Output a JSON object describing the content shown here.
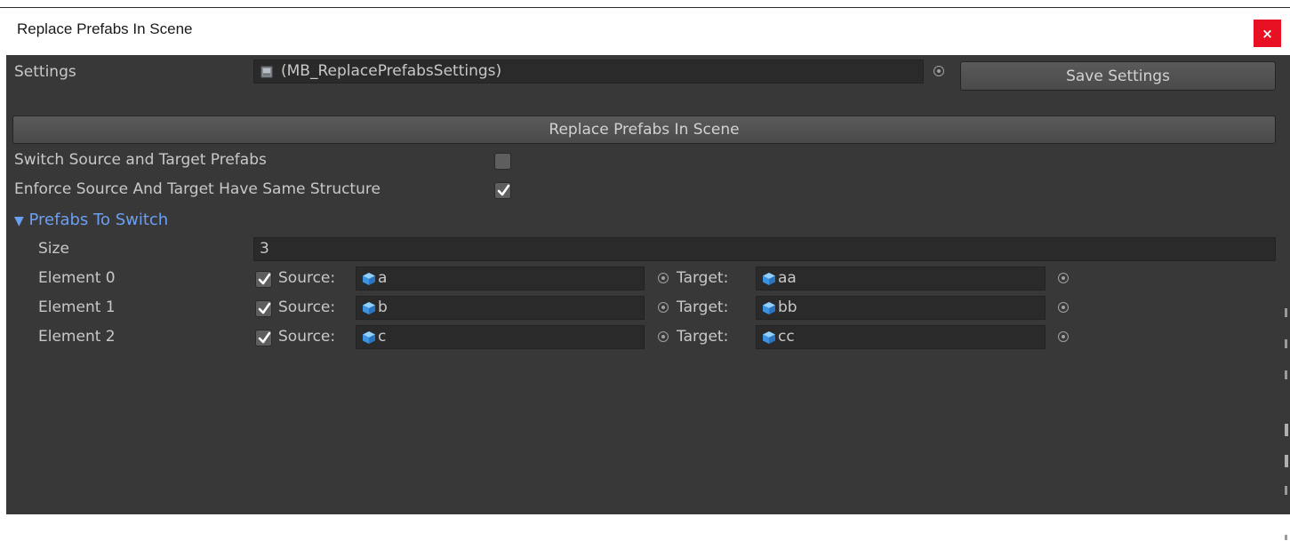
{
  "window": {
    "title": "Replace Prefabs In Scene",
    "close_label": "×"
  },
  "settings": {
    "label": "Settings",
    "value": "(MB_ReplacePrefabsSettings)",
    "save_button": "Save Settings"
  },
  "replace_button": "Replace Prefabs In Scene",
  "options": {
    "switch_label": "Switch Source and Target Prefabs",
    "switch_checked": false,
    "enforce_label": "Enforce Source And Target Have Same Structure",
    "enforce_checked": true
  },
  "prefabs": {
    "foldout_label": "Prefabs To Switch",
    "foldout_arrow": "▼",
    "size_label": "Size",
    "size_value": "3",
    "source_label": "Source:",
    "target_label": "Target:",
    "elements": [
      {
        "label": "Element 0",
        "checked": true,
        "source": "a",
        "target": "aa"
      },
      {
        "label": "Element 1",
        "checked": true,
        "source": "b",
        "target": "bb"
      },
      {
        "label": "Element 2",
        "checked": true,
        "source": "c",
        "target": "cc"
      }
    ]
  },
  "colors": {
    "background": "#383838",
    "field": "#2a2a2a",
    "foldout_accent": "#6c9ff2",
    "close_button": "#e81123",
    "prefab_icon": "#4aa3f0"
  },
  "icons": {
    "settings_asset": "scriptable-object-icon",
    "prefab": "prefab-cube-icon",
    "picker": "object-picker-icon",
    "check": "checkmark-icon"
  }
}
